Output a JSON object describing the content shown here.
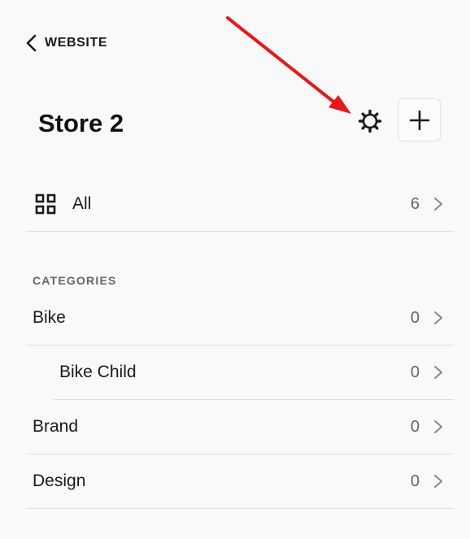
{
  "nav": {
    "back_label": "WEBSITE"
  },
  "header": {
    "title": "Store 2"
  },
  "all_row": {
    "label": "All",
    "count": "6"
  },
  "categories": {
    "heading": "CATEGORIES",
    "items": [
      {
        "label": "Bike",
        "count": "0"
      },
      {
        "label": "Bike Child",
        "count": "0"
      },
      {
        "label": "Brand",
        "count": "0"
      },
      {
        "label": "Design",
        "count": "0"
      }
    ]
  },
  "colors": {
    "annotation_arrow": "#e8181a",
    "divider": "#dedede",
    "background": "#f9f9f9"
  },
  "icons": {
    "back": "chevron-left-icon",
    "settings": "gear-icon",
    "add": "plus-icon",
    "all": "grid-icon",
    "row": "chevron-right-icon"
  }
}
